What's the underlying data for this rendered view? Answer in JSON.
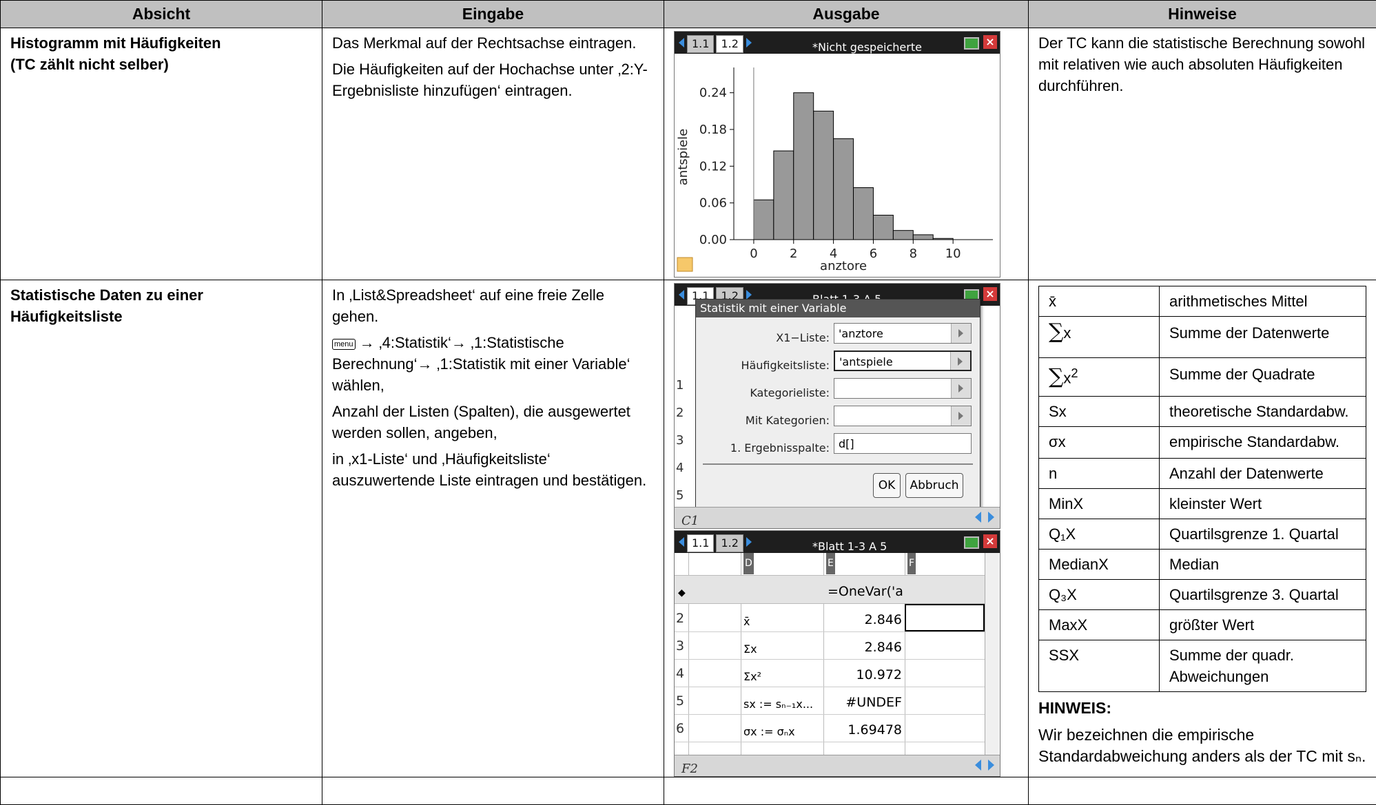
{
  "headers": [
    "Absicht",
    "Eingabe",
    "Ausgabe",
    "Hinweise"
  ],
  "row1": {
    "absicht": [
      "Histogramm mit Häufigkeiten",
      "(TC zählt nicht selber)"
    ],
    "eingabe": [
      "Das Merkmal auf der Rechtsachse eintragen.",
      "Die Häufigkeiten auf der Hochachse unter ‚2:Y-Ergebnisliste hinzufügen‘ eintragen."
    ],
    "hinweise": "Der TC kann die statistische Berechnung sowohl mit relativen wie auch absoluten Häufigkeiten durchführen.",
    "screen": {
      "tab1": "1.1",
      "tab2": "1.2",
      "title": "*Nicht gespeicherte",
      "close": "×"
    }
  },
  "chart_data": {
    "type": "bar",
    "xlabel": "anztore",
    "ylabel": "antspiele",
    "x_ticks": [
      "0",
      "2",
      "4",
      "6",
      "8",
      "10"
    ],
    "y_ticks": [
      "0.00",
      "0.06",
      "0.12",
      "0.18",
      "0.24"
    ],
    "xlim": [
      -1,
      12
    ],
    "ylim": [
      0,
      0.27
    ],
    "bin_width": 1,
    "bins_left": [
      0,
      1,
      2,
      3,
      4,
      5,
      6,
      7,
      8,
      9
    ],
    "values": [
      0.065,
      0.145,
      0.24,
      0.21,
      0.165,
      0.085,
      0.04,
      0.015,
      0.008,
      0.002
    ],
    "grid": false
  },
  "row2": {
    "absicht": "Statistische Daten zu einer Häufigkeitsliste",
    "eingabe": {
      "p1": "In ‚List&Spreadsheet‘ auf eine freie Zelle gehen.",
      "menu_key": "menu",
      "p2": "→ ‚4:Statistik‘→ ‚1:Statistische Berechnung‘→ ‚1:Statistik mit einer Variable‘ wählen,",
      "p3": "Anzahl der Listen (Spalten), die ausgewertet werden sollen, angeben,",
      "p4": "in ‚x1-Liste‘ und ‚Häufigkeitsliste‘ auszuwertende Liste eintragen und bestätigen."
    },
    "screen1": {
      "tab1": "1.1",
      "tab2": "1.2",
      "title": "Blatt 1-3 A 5",
      "close": "×",
      "dialog_title": "Statistik mit einer Variable",
      "fields": [
        {
          "label": "X1−Liste:",
          "value": "'anztore"
        },
        {
          "label": "Häufigkeitsliste:",
          "value": "'antspiele"
        },
        {
          "label": "Kategorieliste:",
          "value": ""
        },
        {
          "label": "Mit Kategorien:",
          "value": ""
        },
        {
          "label": "1. Ergebnisspalte:",
          "value": "d[]"
        }
      ],
      "ok": "OK",
      "cancel": "Abbruch",
      "rows": [
        "1",
        "2",
        "3",
        "4",
        "5"
      ],
      "footer_cell": "C1"
    },
    "screen2": {
      "tab1": "1.1",
      "tab2": "1.2",
      "title": "*Blatt 1-3 A 5",
      "close": "×",
      "cols": [
        "D",
        "E",
        "F"
      ],
      "formula": "=OneVar('a",
      "rows": [
        {
          "n": "2",
          "label": "x̄",
          "value": "2.846"
        },
        {
          "n": "3",
          "label": "Σx",
          "value": "2.846"
        },
        {
          "n": "4",
          "label": "Σx²",
          "value": "10.972"
        },
        {
          "n": "5",
          "label": "sx := sₙ₋₁x...",
          "value": "#UNDEF"
        },
        {
          "n": "6",
          "label": "σx := σₙx",
          "value": "1.69478"
        }
      ],
      "footer_cell": "F2"
    },
    "hinweise": {
      "items": [
        {
          "sym": "x̄",
          "desc": "arithmetisches Mittel"
        },
        {
          "sym": "x",
          "desc": "Summe der Datenwerte"
        },
        {
          "sym": "x",
          "desc": "Summe der Quadrate"
        },
        {
          "sym": "Sx",
          "desc": "theoretische Standardabw."
        },
        {
          "sym": "σx",
          "desc": "empirische Standardabw."
        },
        {
          "sym": "n",
          "desc": "Anzahl der Datenwerte"
        },
        {
          "sym": "MinX",
          "desc": "kleinster Wert"
        },
        {
          "sym": "Q₁X",
          "desc": "Quartilsgrenze 1. Quartal"
        },
        {
          "sym": "MedianX",
          "desc": "Median"
        },
        {
          "sym": "Q₃X",
          "desc": "Quartilsgrenze 3. Quartal"
        },
        {
          "sym": "MaxX",
          "desc": "größter Wert"
        },
        {
          "sym": "SSX",
          "desc": "Summe der quadr. Abweichungen"
        }
      ],
      "note_title": "HINWEIS:",
      "note_text": "Wir bezeichnen die empirische Standardabweichung anders als der TC mit sₙ."
    }
  }
}
